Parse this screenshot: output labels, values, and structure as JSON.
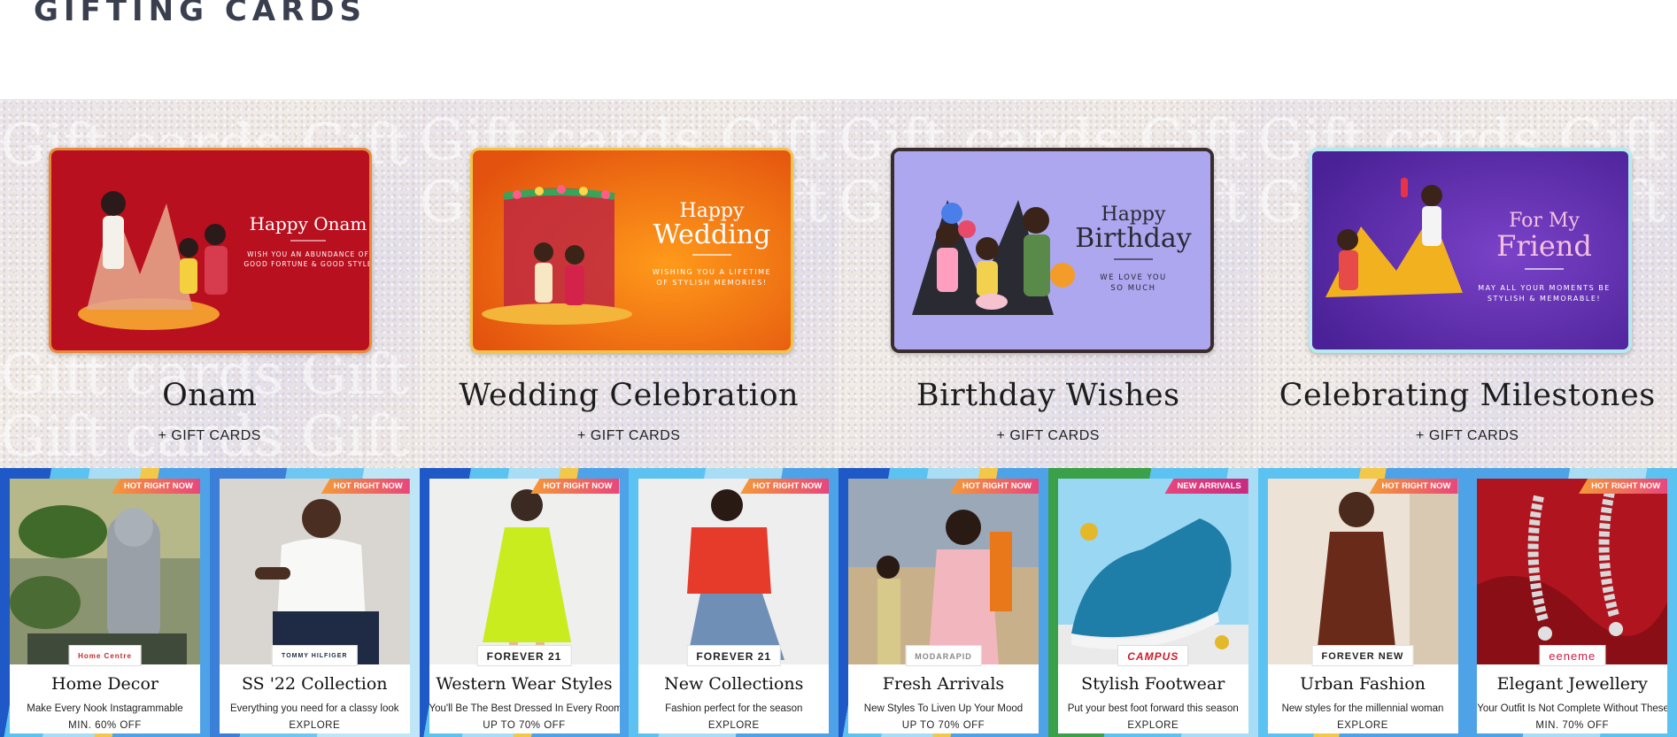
{
  "header": {
    "title": "GIFTING CARDS"
  },
  "watermark_text": "Gift cards Gift cards",
  "gift_cards": [
    {
      "title": "Onam",
      "subtitle": "+ GIFT CARDS",
      "card_heading": "Happy Onam",
      "card_message_line1": "WISH YOU AN ABUNDANCE OF",
      "card_message_line2": "GOOD FORTUNE & GOOD STYLE",
      "bg": "#b01020"
    },
    {
      "title": "Wedding Celebration",
      "subtitle": "+ GIFT CARDS",
      "card_heading_line1": "Happy",
      "card_heading_line2": "Wedding",
      "card_message_line1": "WISHING YOU A LIFETIME",
      "card_message_line2": "OF STYLISH MEMORIES!",
      "bg": "#f06a10"
    },
    {
      "title": "Birthday Wishes",
      "subtitle": "+ GIFT CARDS",
      "card_heading_line1": "Happy",
      "card_heading_line2": "Birthday",
      "card_message_line1": "WE LOVE YOU",
      "card_message_line2": "SO MUCH",
      "bg": "#a9a4ee"
    },
    {
      "title": "Celebrating Milestones",
      "subtitle": "+ GIFT CARDS",
      "card_heading_line1": "For My",
      "card_heading_line2": "Friend",
      "card_message_line1": "MAY ALL YOUR MOMENTS BE",
      "card_message_line2": "STYLISH & MEMORABLE!",
      "bg": "#5a2fb0"
    }
  ],
  "promos": [
    {
      "badge": "HOT RIGHT NOW",
      "brand": "Home Centre",
      "title": "Home Decor",
      "description": "Make Every Nook Instagrammable",
      "offer": "MIN. 60% OFF"
    },
    {
      "badge": "HOT RIGHT NOW",
      "brand": "TOMMY HILFIGER",
      "title": "SS '22 Collection",
      "description": "Everything you need for a classy look",
      "offer": "EXPLORE"
    },
    {
      "badge": "HOT RIGHT NOW",
      "brand": "FOREVER 21",
      "title": "Western Wear Styles",
      "description": "You'll Be The Best Dressed In Every Room",
      "offer": "UP TO 70% OFF"
    },
    {
      "badge": "HOT RIGHT NOW",
      "brand": "FOREVER 21",
      "title": "New Collections",
      "description": "Fashion perfect for the season",
      "offer": "EXPLORE"
    },
    {
      "badge": "HOT RIGHT NOW",
      "brand": "MODARAPID",
      "title": "Fresh Arrivals",
      "description": "New Styles To Liven Up Your Mood",
      "offer": "UP TO 70% OFF"
    },
    {
      "badge": "NEW ARRIVALS",
      "brand": "CAMPUS",
      "title": "Stylish Footwear",
      "description": "Put your best foot forward this season",
      "offer": "EXPLORE"
    },
    {
      "badge": "HOT RIGHT NOW",
      "brand": "FOREVER NEW",
      "title": "Urban Fashion",
      "description": "New styles for the millennial woman",
      "offer": "EXPLORE"
    },
    {
      "badge": "HOT RIGHT NOW",
      "brand": "eeneme",
      "title": "Elegant Jewellery",
      "description": "Your Outfit Is Not Complete Without These",
      "offer": "MIN. 70% OFF"
    }
  ]
}
